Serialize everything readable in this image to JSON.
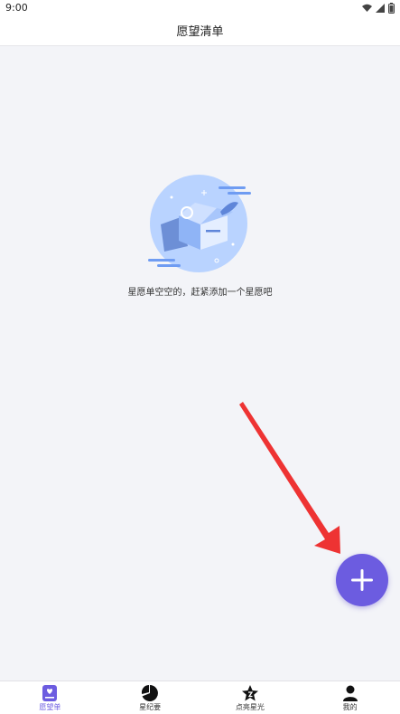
{
  "status_bar": {
    "time": "9:00",
    "icons": [
      "wifi-icon",
      "signal-icon",
      "battery-icon"
    ]
  },
  "header": {
    "title": "愿望清单"
  },
  "empty_state": {
    "message": "星愿单空空的，赶紧添加一个星愿吧",
    "illustration": "empty-box-illustration"
  },
  "fab": {
    "icon": "plus-icon",
    "color": "#6c5ce0"
  },
  "tabbar": {
    "items": [
      {
        "label": "愿望单",
        "icon": "wishlist-icon",
        "active": true
      },
      {
        "label": "星纪要",
        "icon": "pie-chart-icon",
        "active": false
      },
      {
        "label": "点亮星光",
        "icon": "star-icon",
        "active": false
      },
      {
        "label": "我的",
        "icon": "user-icon",
        "active": false
      }
    ]
  },
  "colors": {
    "accent": "#6c5ce0",
    "background": "#f3f4f8",
    "annotation_arrow": "#ee3333"
  }
}
